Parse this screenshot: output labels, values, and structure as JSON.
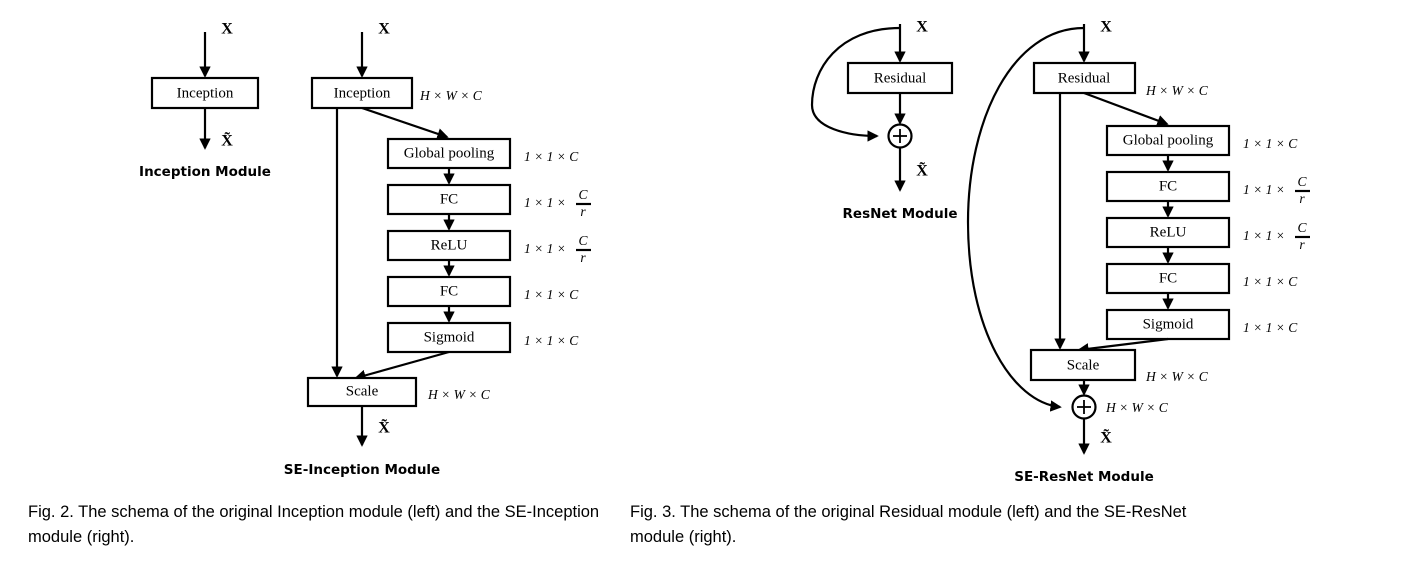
{
  "figure2": {
    "left_module": {
      "title": "Inception Module",
      "input_label": "X",
      "output_label": "X̃",
      "boxes": [
        {
          "label": "Inception"
        }
      ]
    },
    "right_module": {
      "title": "SE-Inception Module",
      "input_label": "X",
      "output_label": "X̃",
      "boxes": [
        {
          "label": "Inception",
          "dim": "H × W × C"
        },
        {
          "label": "Global pooling",
          "dim": "1 × 1 × C"
        },
        {
          "label": "FC",
          "dim_prefix": "1 × 1 ×",
          "dim_num": "C",
          "dim_den": "r"
        },
        {
          "label": "ReLU",
          "dim_prefix": "1 × 1 ×",
          "dim_num": "C",
          "dim_den": "r"
        },
        {
          "label": "FC",
          "dim": "1 × 1 × C"
        },
        {
          "label": "Sigmoid",
          "dim": "1 × 1 × C"
        },
        {
          "label": "Scale",
          "dim": "H × W × C"
        }
      ]
    },
    "caption": "Fig. 2. The schema of the original Inception module (left) and the SE-Inception module (right)."
  },
  "figure3": {
    "left_module": {
      "title": "ResNet Module",
      "input_label": "X",
      "output_label": "X̃",
      "sum_symbol": "+",
      "boxes": [
        {
          "label": "Residual"
        }
      ]
    },
    "right_module": {
      "title": "SE-ResNet Module",
      "input_label": "X",
      "output_label": "X̃",
      "sum_symbol": "+",
      "sum_dim": "H × W × C",
      "boxes": [
        {
          "label": "Residual",
          "dim": "H × W × C"
        },
        {
          "label": "Global pooling",
          "dim": "1 × 1 × C"
        },
        {
          "label": "FC",
          "dim_prefix": "1 × 1 ×",
          "dim_num": "C",
          "dim_den": "r"
        },
        {
          "label": "ReLU",
          "dim_prefix": "1 × 1 ×",
          "dim_num": "C",
          "dim_den": "r"
        },
        {
          "label": "FC",
          "dim": "1 × 1 × C"
        },
        {
          "label": "Sigmoid",
          "dim": "1 × 1 × C"
        },
        {
          "label": "Scale",
          "dim": "H × W × C"
        }
      ]
    },
    "caption": "Fig. 3. The schema of the original Residual module (left) and the SE-ResNet module (right)."
  },
  "colors": {
    "ink": "#000000",
    "paper": "#ffffff"
  }
}
